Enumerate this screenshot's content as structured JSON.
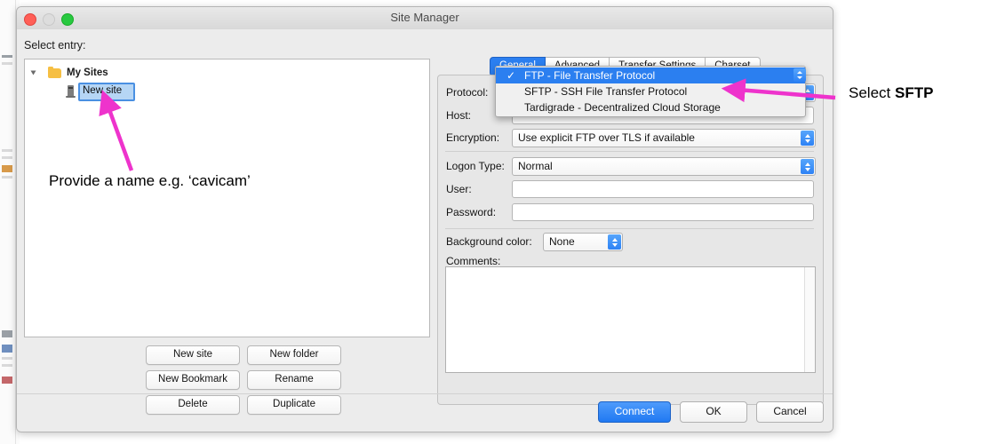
{
  "window": {
    "title": "Site Manager",
    "traffic_lights": [
      "close-button",
      "minimize-button",
      "zoom-button"
    ]
  },
  "left_pane": {
    "label": "Select entry:",
    "tree": {
      "root": {
        "label": "My Sites",
        "icon": "folder-icon",
        "expanded": true
      },
      "child": {
        "label": "New site",
        "icon": "server-icon",
        "editing": true,
        "value": "New site"
      }
    },
    "buttons": [
      {
        "label": "New site",
        "name": "new-site-button"
      },
      {
        "label": "New folder",
        "name": "new-folder-button"
      },
      {
        "label": "New Bookmark",
        "name": "new-bookmark-button"
      },
      {
        "label": "Rename",
        "name": "rename-button"
      },
      {
        "label": "Delete",
        "name": "delete-button"
      },
      {
        "label": "Duplicate",
        "name": "duplicate-button"
      }
    ]
  },
  "right_pane": {
    "tabs": [
      {
        "label": "General",
        "active": true
      },
      {
        "label": "Advanced",
        "active": false
      },
      {
        "label": "Transfer Settings",
        "active": false
      },
      {
        "label": "Charset",
        "active": false
      }
    ],
    "fields": {
      "protocol_label": "Protocol:",
      "protocol_value": "FTP - File Transfer Protocol",
      "host_label": "Host:",
      "host_value": "",
      "encryption_label": "Encryption:",
      "encryption_value": "Use explicit FTP over TLS if available",
      "logon_type_label": "Logon Type:",
      "logon_type_value": "Normal",
      "user_label": "User:",
      "user_value": "",
      "password_label": "Password:",
      "password_value": "",
      "background_color_label": "Background color:",
      "background_color_value": "None",
      "comments_label": "Comments:",
      "comments_value": ""
    },
    "protocol_menu": {
      "open": true,
      "items": [
        {
          "label": "FTP - File Transfer Protocol",
          "selected": true,
          "check": "✓"
        },
        {
          "label": "SFTP - SSH File Transfer Protocol",
          "selected": false,
          "check": ""
        },
        {
          "label": "Tardigrade - Decentralized Cloud Storage",
          "selected": false,
          "check": ""
        }
      ]
    }
  },
  "footer": {
    "connect_label": "Connect",
    "ok_label": "OK",
    "cancel_label": "Cancel"
  },
  "annotations": {
    "left_text": "Provide a name e.g. ‘cavicam’",
    "right_text_prefix": "Select ",
    "right_text_bold": "SFTP",
    "arrow_color": "#ee33cc"
  }
}
